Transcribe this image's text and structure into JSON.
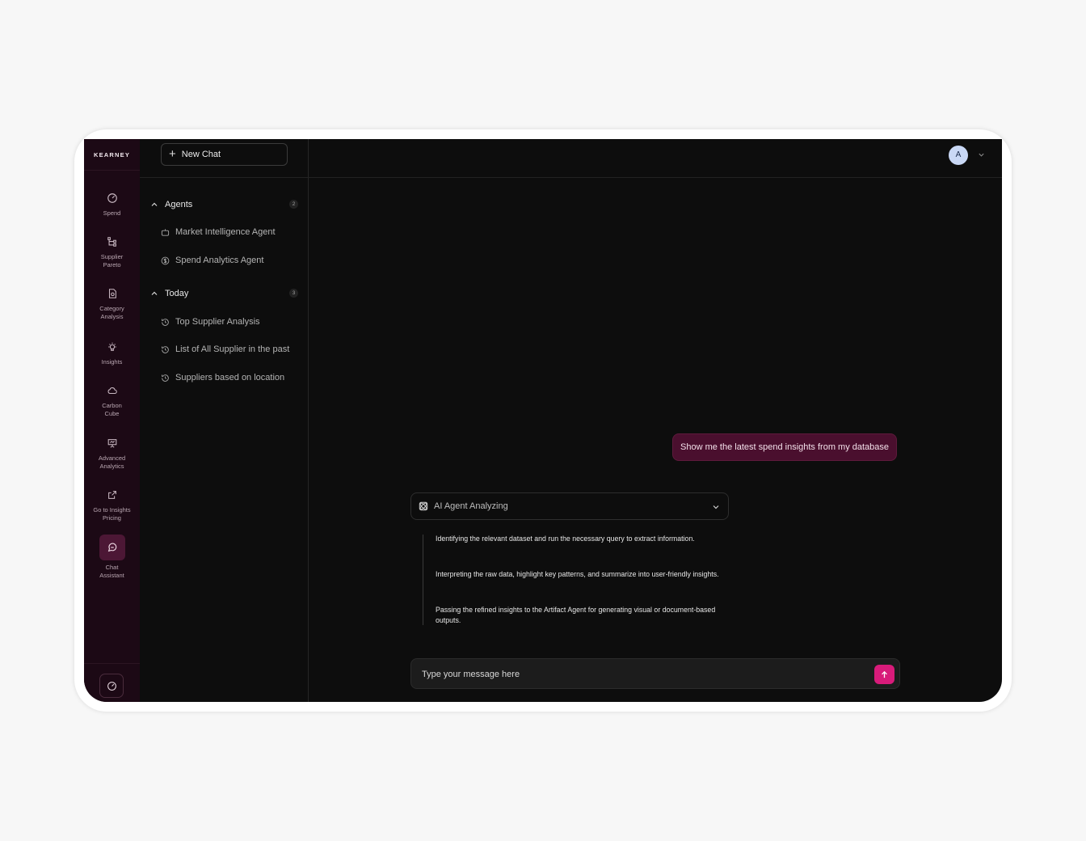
{
  "brand": {
    "logo_text": "KEARNEY"
  },
  "rail": {
    "items": [
      {
        "label": "Spend",
        "icon": "gauge-icon"
      },
      {
        "label": "Supplier Pareto",
        "icon": "hierarchy-icon"
      },
      {
        "label": "Category Analysis",
        "icon": "file-icon"
      },
      {
        "label": "Insights",
        "icon": "lightbulb-icon"
      },
      {
        "label": "Carbon Cube",
        "icon": "cloud-icon"
      },
      {
        "label": "Advanced Analytics",
        "icon": "presentation-icon"
      },
      {
        "label": "Go to Insights Pricing",
        "icon": "external-link-icon"
      },
      {
        "label": "Chat Assistant",
        "icon": "chat-icon",
        "active": true
      }
    ],
    "bottom_icon": "gauge-icon"
  },
  "sidebar": {
    "new_chat_label": "New Chat",
    "groups": [
      {
        "title": "Agents",
        "count": "2",
        "items": [
          {
            "label": "Market Intelligence Agent",
            "icon": "robot-icon"
          },
          {
            "label": "Spend Analytics Agent",
            "icon": "dollar-icon"
          }
        ]
      },
      {
        "title": "Today",
        "count": "3",
        "items": [
          {
            "label": "Top Supplier Analysis",
            "icon": "history-icon"
          },
          {
            "label": "List of All Supplier in the past",
            "icon": "history-icon"
          },
          {
            "label": "Suppliers based on location",
            "icon": "history-icon"
          }
        ]
      }
    ]
  },
  "header": {
    "avatar_initial": "A"
  },
  "chat": {
    "user_message": "Show me the latest spend insights from my database",
    "agent_status": "AI Agent Analyzing",
    "steps": [
      "Identifying the relevant dataset and run the necessary query to extract information.",
      "Interpreting the raw data, highlight key patterns, and summarize into user-friendly insights.",
      "Passing the refined insights to the Artifact Agent for generating visual or document-based outputs."
    ],
    "input_placeholder": "Type your message here"
  },
  "colors": {
    "accent": "#d81b7a",
    "rail_bg": "#1c0915",
    "user_bubble": "#4a0f2e",
    "main_bg": "#0d0d0d"
  }
}
